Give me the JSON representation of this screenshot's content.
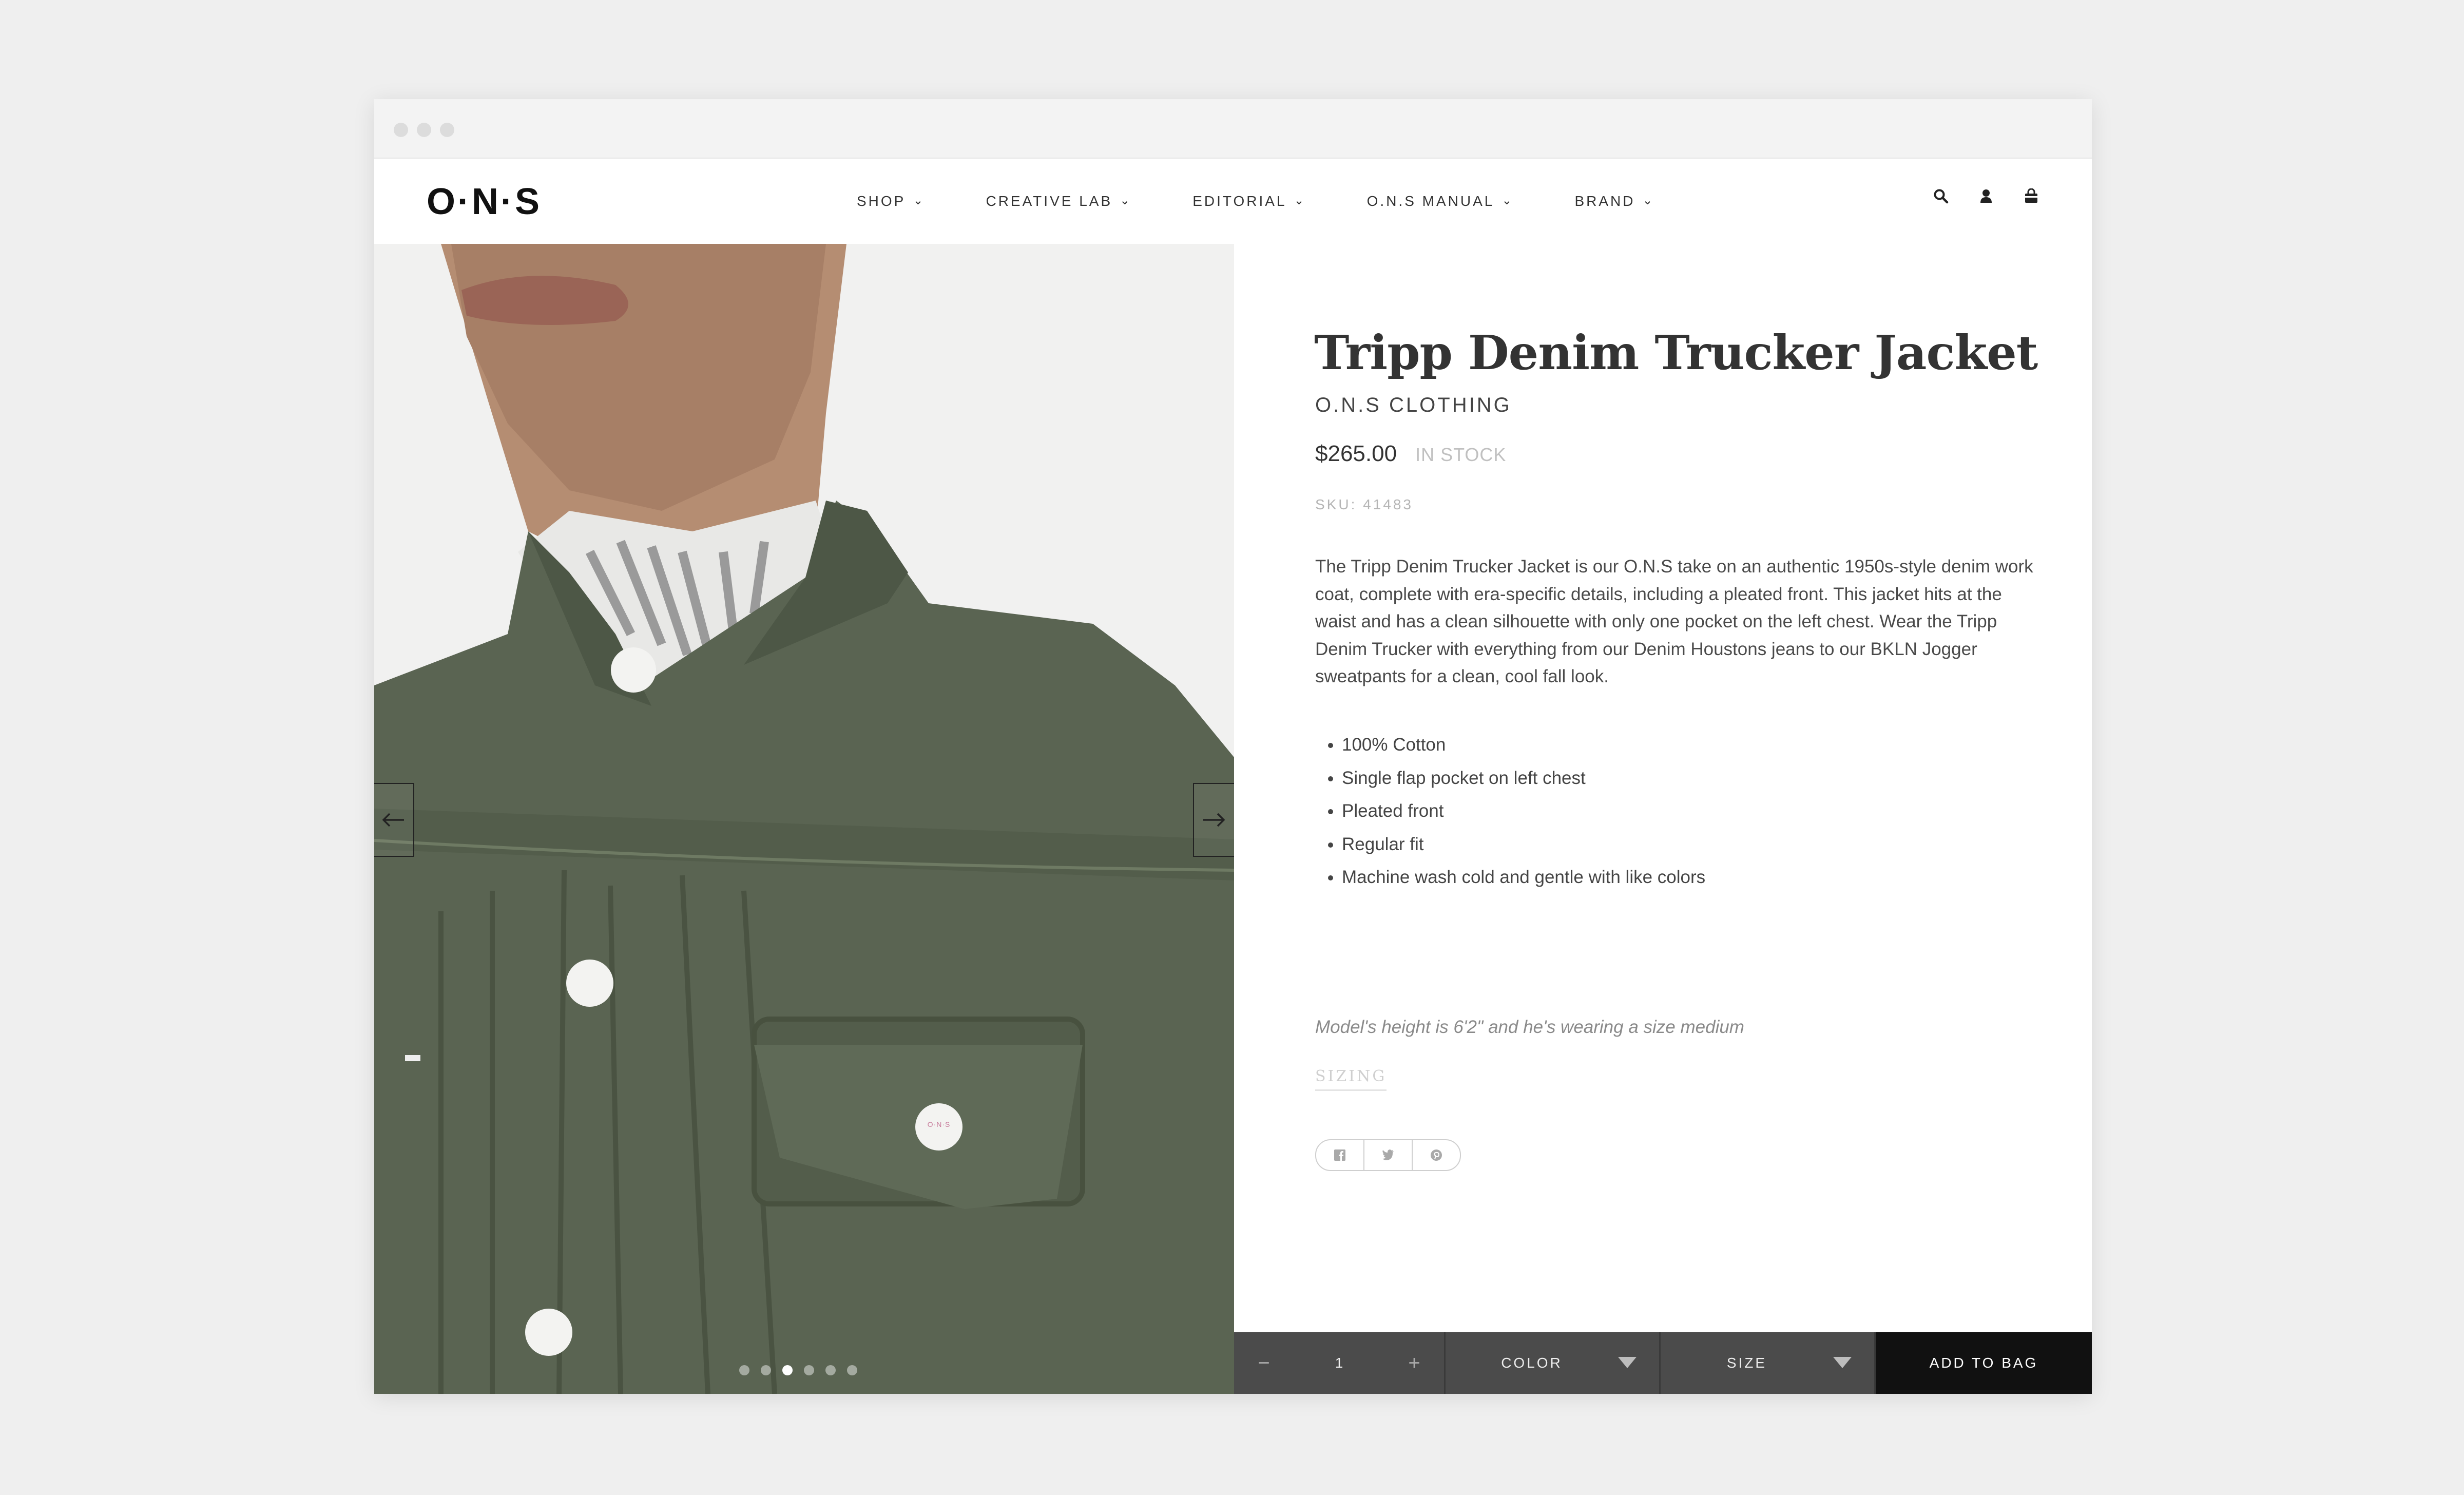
{
  "colors": {
    "page_bg": "#efefef",
    "jacket": "#5a6452",
    "buy_bar": "#4b4b4b",
    "add_to_bag": "#111111"
  },
  "header": {
    "logo": "O·N·S",
    "menu": [
      {
        "label": "SHOP"
      },
      {
        "label": "CREATIVE LAB"
      },
      {
        "label": "EDITORIAL"
      },
      {
        "label": "O.N.S MANUAL"
      },
      {
        "label": "BRAND"
      }
    ],
    "icons": [
      "search-icon",
      "account-icon",
      "bag-icon"
    ]
  },
  "gallery": {
    "slide_count": 6,
    "active_slide": 3,
    "button_text": "O·N·S"
  },
  "product": {
    "title": "Tripp Denim Trucker Jacket",
    "brand": "O.N.S CLOTHING",
    "price": "$265.00",
    "stock": "IN STOCK",
    "sku": "SKU: 41483",
    "description": "The Tripp Denim Trucker Jacket is our O.N.S take on an authentic 1950s-style denim work coat, complete with era-specific details, including a pleated front. This jacket hits at the waist and has a clean silhouette with only one pocket on the left chest. Wear the Tripp Denim Trucker with everything from our Denim Houstons jeans to our BKLN Jogger sweatpants for a clean, cool fall look.",
    "features": [
      "100% Cotton",
      "Single flap pocket on left chest",
      "Pleated front",
      "Regular fit",
      "Machine wash cold and gentle with like colors"
    ],
    "model_note": "Model's height is 6'2\" and he's wearing a size medium",
    "sizing_link": "SIZING",
    "share": [
      "facebook-icon",
      "twitter-icon",
      "pinterest-icon"
    ]
  },
  "buy_bar": {
    "quantity": "1",
    "minus": "−",
    "plus": "+",
    "color_label": "COLOR",
    "size_label": "SIZE",
    "add_label": "ADD TO BAG"
  }
}
